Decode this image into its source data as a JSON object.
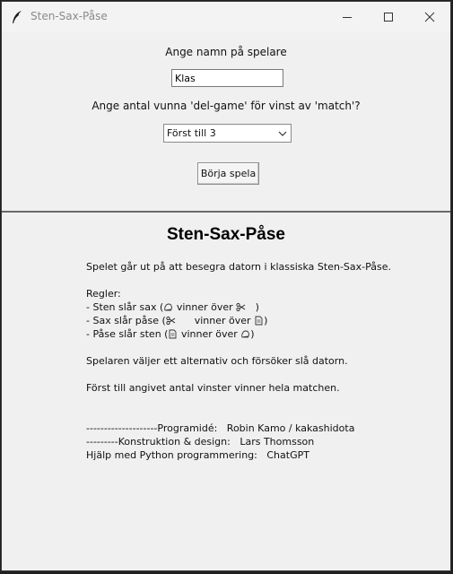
{
  "window": {
    "title": "Sten-Sax-Påse",
    "icons": {
      "app": "feather-icon",
      "minimize": "minimize-icon",
      "maximize": "maximize-icon",
      "close": "close-icon"
    }
  },
  "setup": {
    "name_prompt": "Ange namn på spelare",
    "name_value": "Klas",
    "wins_prompt": "Ange antal vunna 'del-game' för vinst av 'match'?",
    "wins_selected": "Först till 3",
    "start_button": "Börja spela"
  },
  "info": {
    "title": "Sten-Sax-Påse",
    "intro": "Spelet går ut på att besegra datorn i klassiska Sten-Sax-Påse.",
    "rules_heading": "Regler:",
    "rule1_a": "- Sten slår sax (",
    "rule1_b": " vinner över ",
    "rule1_c": "   )",
    "rule2_a": "- Sax slår påse (",
    "rule2_b": "      vinner över ",
    "rule2_c": ")",
    "rule3_a": "- Påse slår sten (",
    "rule3_b": " vinner över ",
    "rule3_c": ")",
    "player_choice": "Spelaren väljer ett alternativ och försöker slå datorn.",
    "first_to": "Först till angivet antal vinster vinner hela matchen.",
    "credit1": "--------------------Programidé:   Robin Kamo / kakashidota",
    "credit2": "---------Konstruktion & design:   Lars Thomsson",
    "credit3": "Hjälp med Python programmering:   ChatGPT"
  }
}
